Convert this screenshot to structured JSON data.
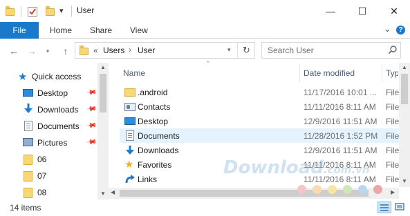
{
  "window": {
    "title": "User",
    "controls": {
      "minimize": "—",
      "maximize": "☐",
      "close": "✕"
    }
  },
  "ribbon": {
    "tabs": [
      "File",
      "Home",
      "Share",
      "View"
    ],
    "collapse_glyph": "⌄",
    "help_glyph": "?"
  },
  "address": {
    "overflow": "«",
    "crumbs": [
      "Users",
      "User"
    ],
    "separator": "›",
    "search_placeholder": "Search User"
  },
  "navpane": {
    "items": [
      {
        "label": "Quick access",
        "icon": "star-icon",
        "pinned": false
      },
      {
        "label": "Desktop",
        "icon": "desktop-icon",
        "pinned": true
      },
      {
        "label": "Downloads",
        "icon": "download-icon",
        "pinned": true
      },
      {
        "label": "Documents",
        "icon": "document-icon",
        "pinned": true
      },
      {
        "label": "Pictures",
        "icon": "pictures-icon",
        "pinned": true
      },
      {
        "label": "06",
        "icon": "folder-icon",
        "pinned": false
      },
      {
        "label": "07",
        "icon": "folder-icon",
        "pinned": false
      },
      {
        "label": "08",
        "icon": "folder-icon",
        "pinned": false
      }
    ]
  },
  "filelist": {
    "columns": {
      "name": "Name",
      "date": "Date modified",
      "type": "Typ"
    },
    "rows": [
      {
        "name": ".android",
        "date": "11/17/2016 10:01 ...",
        "type": "File",
        "icon": "folder-icon"
      },
      {
        "name": "Contacts",
        "date": "11/11/2016 8:11 AM",
        "type": "File",
        "icon": "contacts-icon"
      },
      {
        "name": "Desktop",
        "date": "12/9/2016 11:51 AM",
        "type": "File",
        "icon": "desktop-icon"
      },
      {
        "name": "Documents",
        "date": "11/28/2016 1:52 PM",
        "type": "File",
        "icon": "document-icon",
        "selected": true
      },
      {
        "name": "Downloads",
        "date": "12/9/2016 11:51 AM",
        "type": "File",
        "icon": "download-icon"
      },
      {
        "name": "Favorites",
        "date": "11/11/2016 8:11 AM",
        "type": "File",
        "icon": "favorites-star-icon"
      },
      {
        "name": "Links",
        "date": "11/11/2016 8:11 AM",
        "type": "File",
        "icon": "links-icon"
      }
    ]
  },
  "status": {
    "item_count": "14 items"
  },
  "watermark": {
    "text": "Download",
    "tld": ".com.vn"
  },
  "colors": {
    "accent": "#1979ca",
    "folder": "#f8d775",
    "selection": "#e5f3ff",
    "header_text": "#4c607a",
    "watermark_dots": [
      "#f6c6c6",
      "#f8dcb0",
      "#f7e6a5",
      "#cfe6b8",
      "#b9d8ef",
      "#e8a8a8"
    ]
  }
}
